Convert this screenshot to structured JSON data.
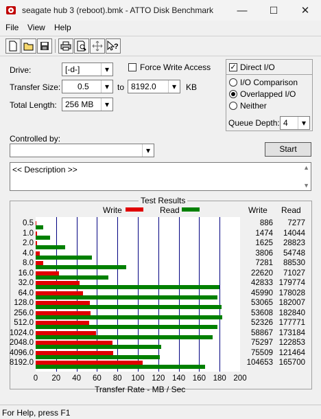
{
  "window": {
    "title": "seagate hub 3 (reboot).bmk - ATTO Disk Benchmark",
    "minimize": "—",
    "maximize": "☐",
    "close": "✕"
  },
  "menu": [
    "File",
    "View",
    "Help"
  ],
  "toolbar": [
    "new-icon",
    "open-icon",
    "save-icon",
    "print-icon",
    "print-preview-icon",
    "move-icon",
    "context-help-icon"
  ],
  "form": {
    "drive_label": "Drive:",
    "drive_value": "[-d-]",
    "transfer_size_label": "Transfer Size:",
    "transfer_from": "0.5",
    "transfer_to_label": "to",
    "transfer_to": "8192.0",
    "transfer_unit": "KB",
    "total_length_label": "Total Length:",
    "total_length_value": "256 MB",
    "force_write_label": "Force Write Access",
    "force_write_checked": false,
    "direct_io_label": "Direct I/O",
    "direct_io_checked": true,
    "io_comparison_label": "I/O Comparison",
    "overlapped_io_label": "Overlapped I/O",
    "neither_label": "Neither",
    "io_mode": "overlapped",
    "queue_depth_label": "Queue Depth:",
    "queue_depth_value": "4",
    "controlled_by_label": "Controlled by:",
    "controlled_by_value": "",
    "start_label": "Start",
    "description": "<< Description >>"
  },
  "results": {
    "group_title": "Test Results",
    "legend_write": "Write",
    "legend_read": "Read",
    "col_write": "Write",
    "col_read": "Read"
  },
  "colors": {
    "write": "#e00000",
    "read": "#008000",
    "grid": "#000080"
  },
  "chart_data": {
    "type": "bar",
    "orientation": "horizontal",
    "categories": [
      "0.5",
      "1.0",
      "2.0",
      "4.0",
      "8.0",
      "16.0",
      "32.0",
      "64.0",
      "128.0",
      "256.0",
      "512.0",
      "1024.0",
      "2048.0",
      "4096.0",
      "8192.0"
    ],
    "series": [
      {
        "name": "Write",
        "values": [
          886,
          1474,
          1625,
          3806,
          7281,
          22620,
          42833,
          45990,
          53065,
          53608,
          52326,
          58867,
          75297,
          75509,
          104653
        ]
      },
      {
        "name": "Read",
        "values": [
          7277,
          14044,
          28823,
          54748,
          88530,
          71027,
          179774,
          178028,
          182007,
          182840,
          177771,
          173184,
          122853,
          121464,
          165700
        ]
      }
    ],
    "xlabel": "Transfer Rate - MB / Sec",
    "ylabel": "",
    "xlim": [
      0,
      200
    ],
    "xticks": [
      "0",
      "20",
      "40",
      "60",
      "80",
      "100",
      "120",
      "140",
      "160",
      "180",
      "200"
    ],
    "grid": true,
    "legend": "top"
  },
  "status": "For Help, press F1"
}
